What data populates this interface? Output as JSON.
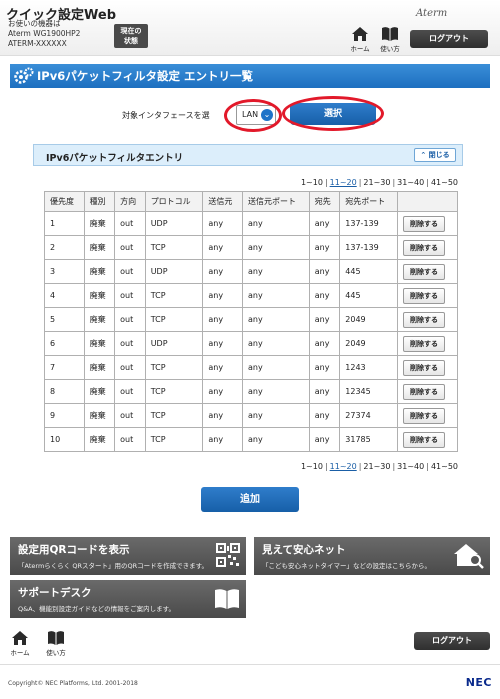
{
  "header": {
    "app_title": "クイック設定Web",
    "device_line1": "お使いの機器は",
    "device_line2": "Aterm WG1900HP2",
    "device_line3": "ATERM-XXXXXX",
    "status_label_1": "現在の",
    "status_label_2": "状態",
    "brand": "Aterm",
    "home_label": "ホーム",
    "manual_label": "使い方",
    "logout_label": "ログアウト"
  },
  "page": {
    "title": "IPv6パケットフィルタ設定 エントリ一覧",
    "interface_label": "対象インタフェースを選",
    "interface_value": "LAN",
    "select_button": "選択",
    "section_title": "IPv6パケットフィルタエントリ",
    "collapse_button": "閉じる",
    "add_button": "追加"
  },
  "pagination": {
    "pages": [
      {
        "label": "1~10",
        "link": false
      },
      {
        "label": "11~20",
        "link": true
      },
      {
        "label": "21~30",
        "link": false
      },
      {
        "label": "31~40",
        "link": false
      },
      {
        "label": "41~50",
        "link": false
      }
    ]
  },
  "table": {
    "headers": [
      "優先度",
      "種別",
      "方向",
      "プロトコル",
      "送信元",
      "送信元ポート",
      "宛先",
      "宛先ポート",
      ""
    ],
    "delete_label": "削除する",
    "rows": [
      [
        "1",
        "廃棄",
        "out",
        "UDP",
        "any",
        "any",
        "any",
        "137-139"
      ],
      [
        "2",
        "廃棄",
        "out",
        "TCP",
        "any",
        "any",
        "any",
        "137-139"
      ],
      [
        "3",
        "廃棄",
        "out",
        "UDP",
        "any",
        "any",
        "any",
        "445"
      ],
      [
        "4",
        "廃棄",
        "out",
        "TCP",
        "any",
        "any",
        "any",
        "445"
      ],
      [
        "5",
        "廃棄",
        "out",
        "TCP",
        "any",
        "any",
        "any",
        "2049"
      ],
      [
        "6",
        "廃棄",
        "out",
        "UDP",
        "any",
        "any",
        "any",
        "2049"
      ],
      [
        "7",
        "廃棄",
        "out",
        "TCP",
        "any",
        "any",
        "any",
        "1243"
      ],
      [
        "8",
        "廃棄",
        "out",
        "TCP",
        "any",
        "any",
        "any",
        "12345"
      ],
      [
        "9",
        "廃棄",
        "out",
        "TCP",
        "any",
        "any",
        "any",
        "27374"
      ],
      [
        "10",
        "廃棄",
        "out",
        "TCP",
        "any",
        "any",
        "any",
        "31785"
      ]
    ]
  },
  "cards": {
    "qr": {
      "title": "設定用QRコードを表示",
      "desc": "「Atermらくらく QRスタート」用のQRコードを作成できます。",
      "icon": "qr-code-icon"
    },
    "safety": {
      "title": "見えて安心ネット",
      "desc": "「こども安心ネットタイマー」などの設定はこちらから。",
      "icon": "house-search-icon"
    },
    "support": {
      "title": "サポートデスク",
      "desc": "Q&A、機能別設定ガイドなどの情報をご案内します。",
      "icon": "book-icon"
    }
  },
  "footer": {
    "home_label": "ホーム",
    "manual_label": "使い方",
    "logout_label": "ログアウト",
    "copyright": "Copyright© NEC Platforms, Ltd. 2001-2018",
    "logo": "NEC"
  },
  "colors": {
    "accent_blue": "#1e73c8",
    "highlight_red": "#e2192a",
    "dark_button": "#3a3a3a"
  }
}
